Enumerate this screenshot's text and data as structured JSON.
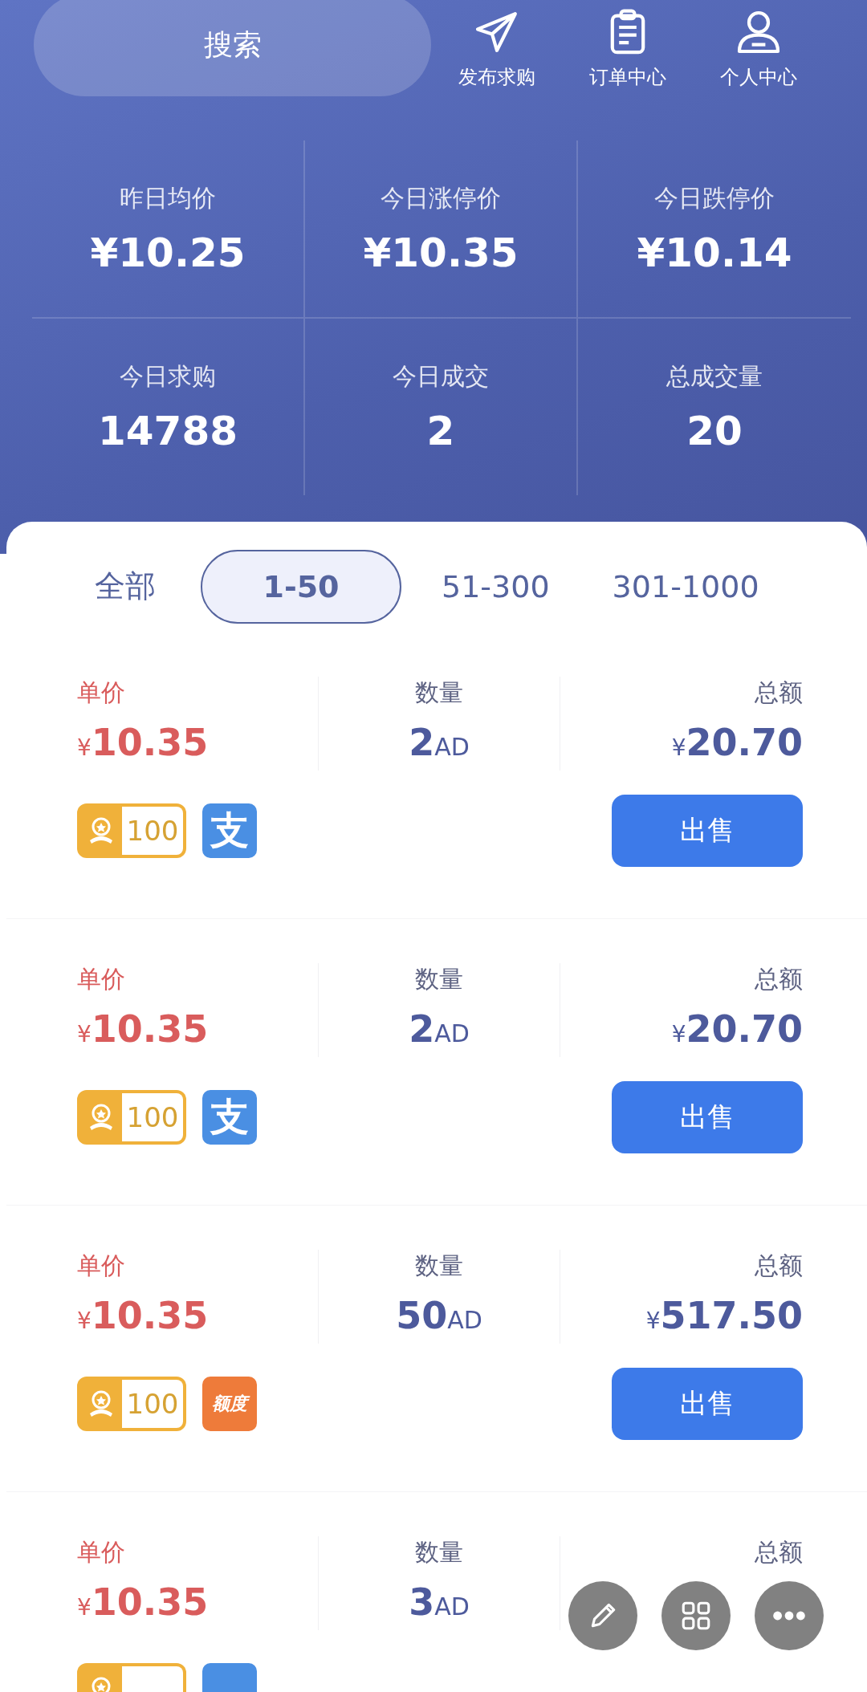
{
  "search": {
    "placeholder": "搜索"
  },
  "actions": [
    {
      "kind": "send",
      "label": "发布求购"
    },
    {
      "kind": "orders",
      "label": "订单中心"
    },
    {
      "kind": "profile",
      "label": "个人中心"
    }
  ],
  "stats": [
    {
      "label": "昨日均价",
      "value": "¥10.25"
    },
    {
      "label": "今日涨停价",
      "value": "¥10.35"
    },
    {
      "label": "今日跌停价",
      "value": "¥10.14"
    },
    {
      "label": "今日求购",
      "value": "14788"
    },
    {
      "label": "今日成交",
      "value": "2"
    },
    {
      "label": "总成交量",
      "value": "20"
    }
  ],
  "tabs": [
    {
      "label": "全部",
      "selected": false
    },
    {
      "label": "1-50",
      "selected": true
    },
    {
      "label": "51-300",
      "selected": false
    },
    {
      "label": "301-1000",
      "selected": false
    }
  ],
  "orders": [
    {
      "price_label": "单价",
      "currency": "¥",
      "price": "10.35",
      "qty_label": "数量",
      "qty": "2",
      "unit": "AD",
      "total_label": "总额",
      "total": "20.70",
      "medal": true,
      "score": "100",
      "pay": {
        "kind": "alipay",
        "label": "支"
      },
      "action": "出售"
    },
    {
      "price_label": "单价",
      "currency": "¥",
      "price": "10.35",
      "qty_label": "数量",
      "qty": "2",
      "unit": "AD",
      "total_label": "总额",
      "total": "20.70",
      "medal": true,
      "score": "100",
      "pay": {
        "kind": "alipay",
        "label": "支"
      },
      "action": "出售"
    },
    {
      "price_label": "单价",
      "currency": "¥",
      "price": "10.35",
      "qty_label": "数量",
      "qty": "50",
      "unit": "AD",
      "total_label": "总额",
      "total": "517.50",
      "medal": true,
      "score": "100",
      "pay": {
        "kind": "credit",
        "label": "额度"
      },
      "action": "出售"
    },
    {
      "price_label": "单价",
      "currency": "¥",
      "price": "10.35",
      "qty_label": "数量",
      "qty": "3",
      "unit": "AD",
      "total_label": "总额",
      "medal": true,
      "pay": {
        "kind": "alipay"
      }
    }
  ],
  "floating": [
    {
      "kind": "edit"
    },
    {
      "kind": "apps"
    },
    {
      "kind": "more"
    }
  ]
}
